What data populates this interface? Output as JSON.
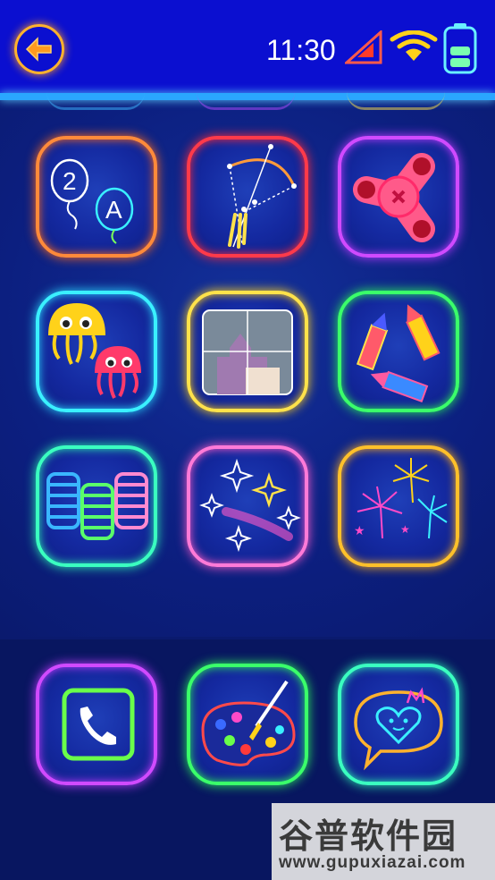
{
  "status_bar": {
    "time": "11:30",
    "signal_color": "#ff4a3a",
    "wifi_color": "#ffd21a",
    "battery_color": "#6af0ff"
  },
  "header": {
    "back_icon": "back-arrow-icon",
    "back_color": "#ffb22e"
  },
  "apps": [
    {
      "name": "balloons-numbers-letters",
      "icon": "balloons-icon",
      "glow": "#ff7a2a"
    },
    {
      "name": "bow-arrow-constellation",
      "icon": "bow-icon",
      "glow": "#ff2a3a"
    },
    {
      "name": "fidget-spinner",
      "icon": "spinner-icon",
      "glow": "#d04aff"
    },
    {
      "name": "jellyfish",
      "icon": "jellyfish-icon",
      "glow": "#3af0ff"
    },
    {
      "name": "castle-puzzle",
      "icon": "puzzle-icon",
      "glow": "#ffe24a"
    },
    {
      "name": "fireworks-rockets",
      "icon": "rocket-icon",
      "glow": "#3aff6a"
    },
    {
      "name": "coin-stacks",
      "icon": "coins-icon",
      "glow": "#3affc0"
    },
    {
      "name": "sparkles",
      "icon": "sparkle-icon",
      "glow": "#ff7ad8"
    },
    {
      "name": "fireworks",
      "icon": "fireworks-icon",
      "glow": "#ffc02a"
    }
  ],
  "dock": [
    {
      "name": "phone",
      "icon": "phone-icon",
      "glow": "#d04aff"
    },
    {
      "name": "paint-palette",
      "icon": "palette-icon",
      "glow": "#3aff6a"
    },
    {
      "name": "heart-message",
      "icon": "heart-chat-icon",
      "glow": "#3affc0"
    }
  ],
  "watermark": {
    "title": "谷普软件园",
    "url": "www.gupuxiazai.com"
  }
}
